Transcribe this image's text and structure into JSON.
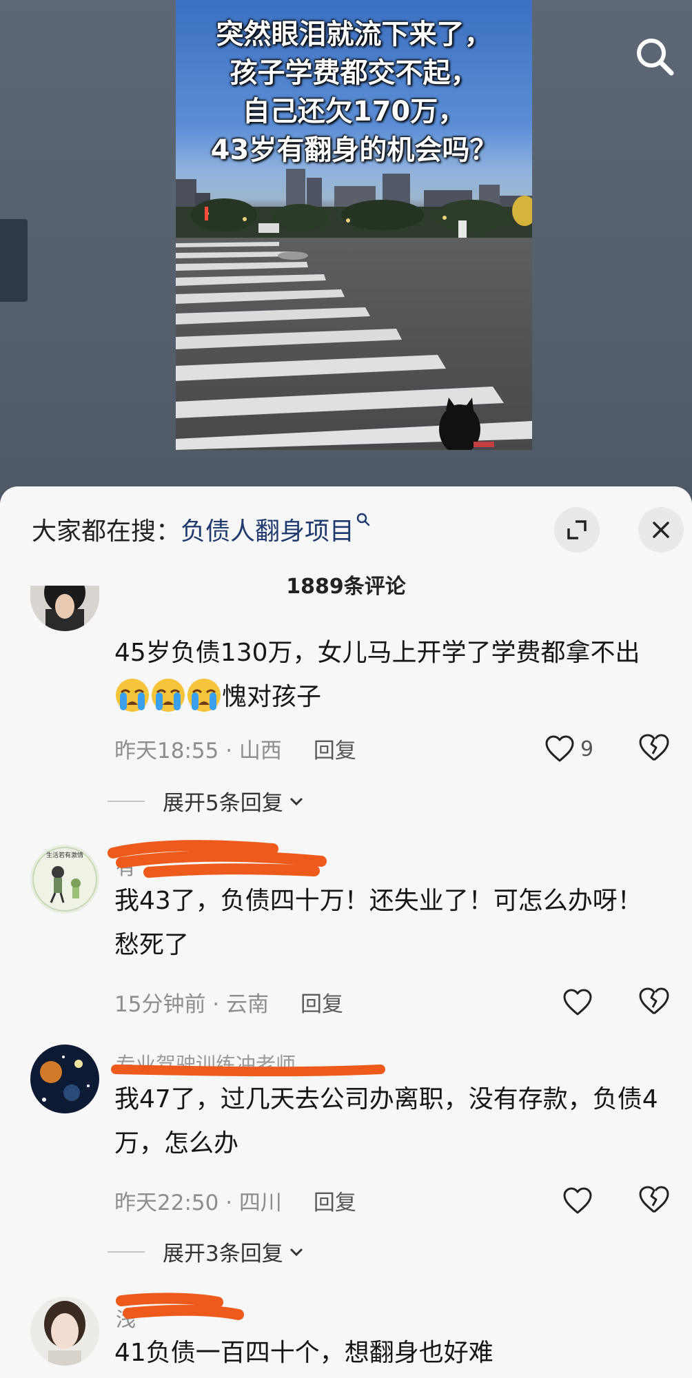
{
  "video": {
    "caption_lines": [
      "突然眼泪就流下来了，",
      "孩子学费都交不起，",
      "自己还欠170万，",
      "43岁有翻身的机会吗？"
    ]
  },
  "icons": {
    "search": "search-icon",
    "expand": "expand-icon",
    "close": "close-icon",
    "like": "heart-icon",
    "dislike": "broken-heart-icon",
    "chevron": "chevron-down-icon",
    "crying_emoji": "crying-face-emoji"
  },
  "panel": {
    "trend_label": "大家都在搜：",
    "trend_keyword": "负债人翻身项目",
    "comment_count": "1889条评论"
  },
  "comments": [
    {
      "username": "",
      "text_before_emoji": "45岁负债130万，女儿马上开学了学费都拿不出",
      "text_after_emoji": "愧对孩子",
      "time": "昨天18:55",
      "location": "山西",
      "reply_label": "回复",
      "likes": "9",
      "expand_replies": "展开5条回复"
    },
    {
      "username": "有",
      "text": "我43了，负债四十万！还失业了！可怎么办呀！愁死了",
      "time": "15分钟前",
      "location": "云南",
      "reply_label": "回复"
    },
    {
      "username": "专业驾驶训练冲老师",
      "text": "我47了，过几天去公司办离职，没有存款，负债4万，怎么办",
      "time": "昨天22:50",
      "location": "四川",
      "reply_label": "回复",
      "expand_replies": "展开3条回复"
    },
    {
      "username": "浅",
      "text": "41负债一百四十个，想翻身也好难"
    }
  ],
  "colors": {
    "panel_bg": "#f7f7f7",
    "keyword": "#1e3a6e",
    "scribble": "#ee5a1c"
  }
}
